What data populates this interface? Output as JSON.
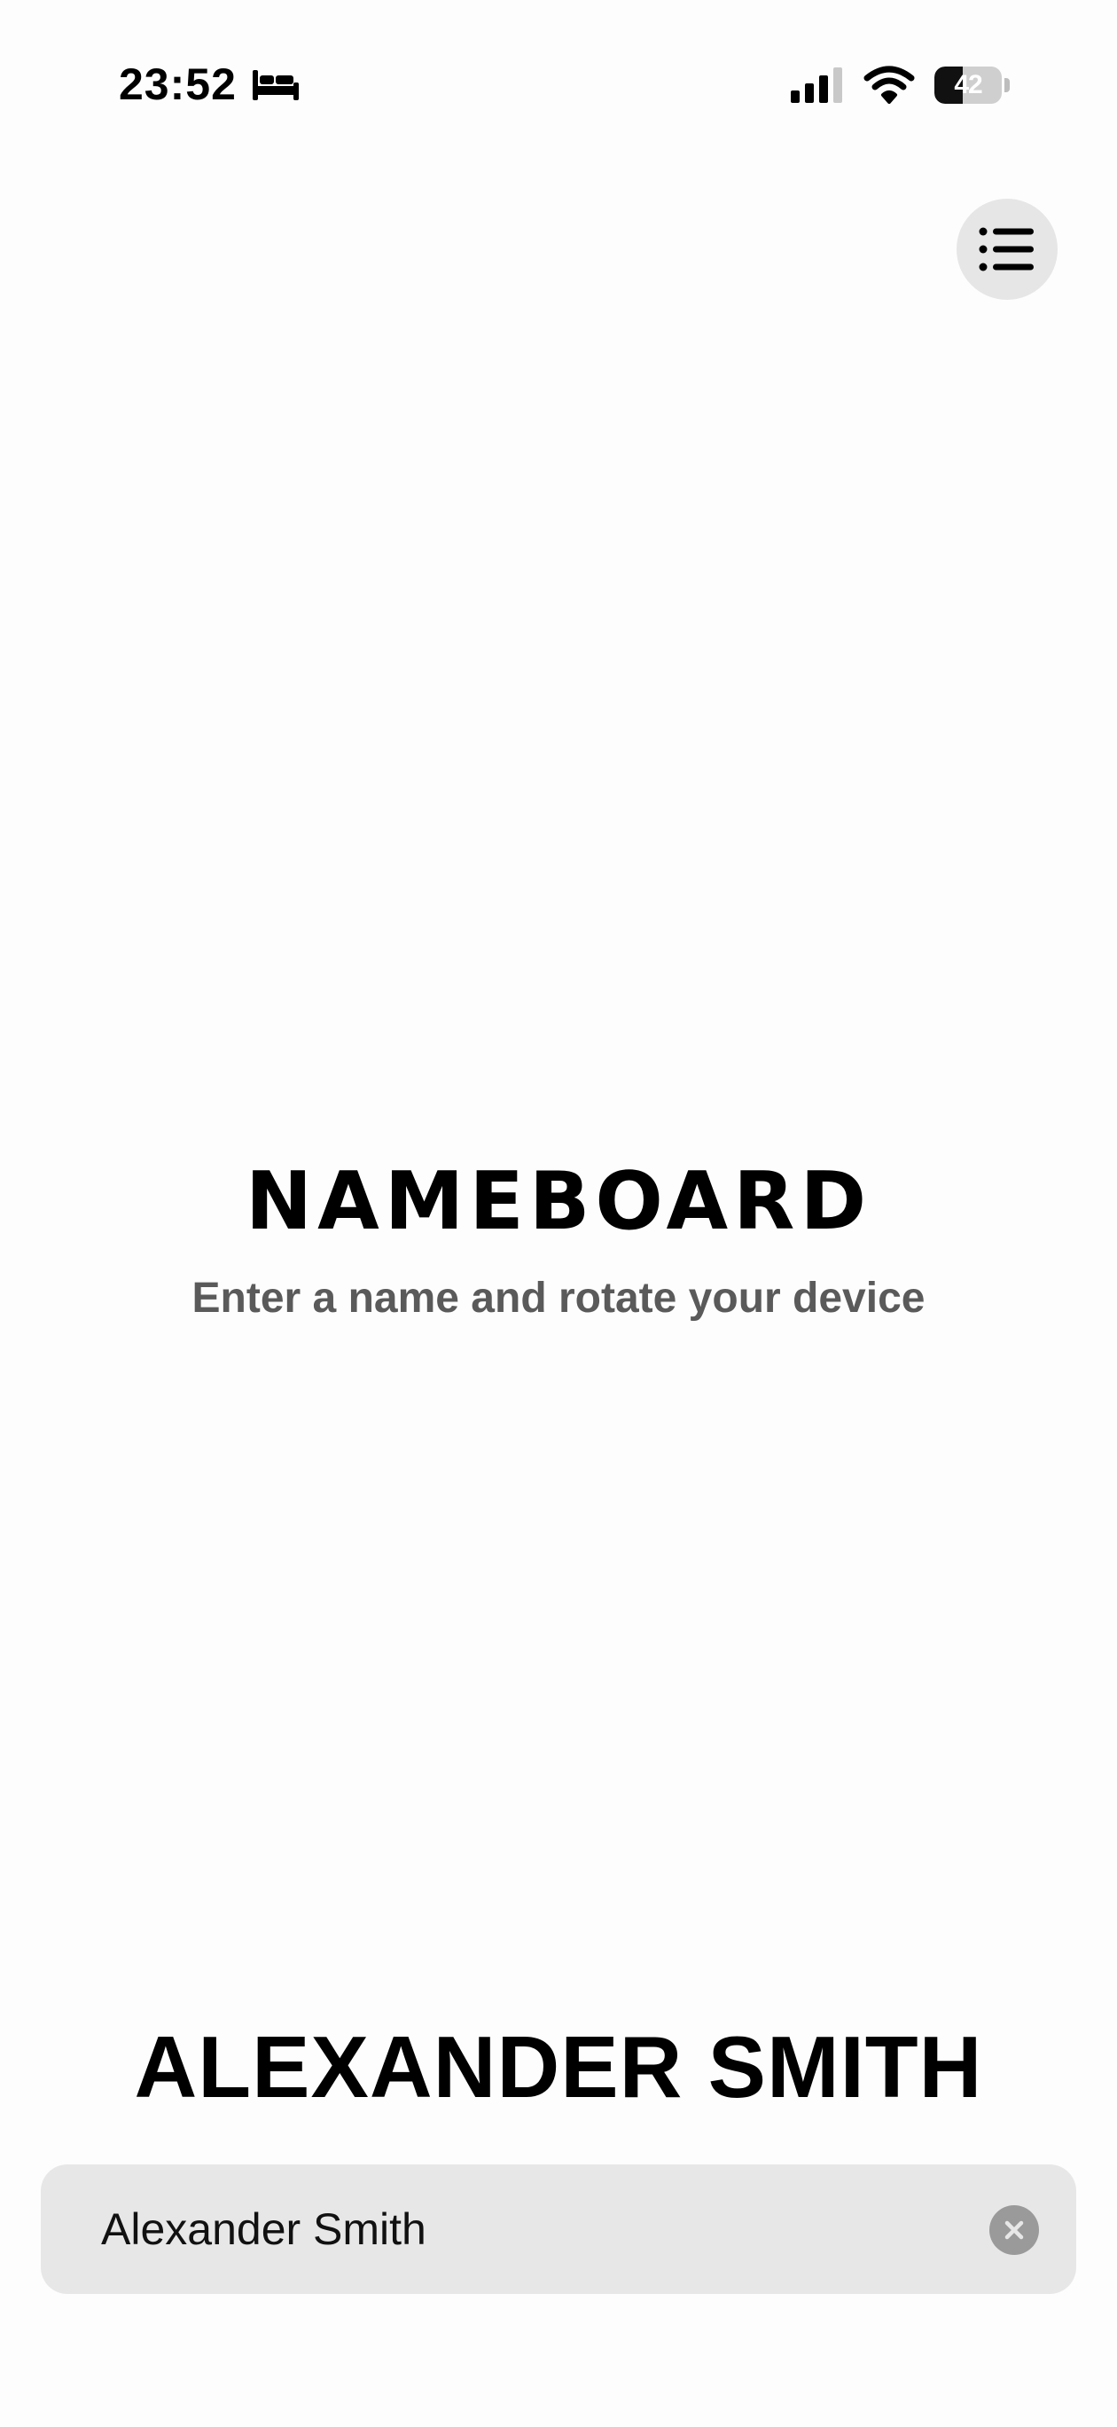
{
  "status_bar": {
    "time": "23:52",
    "focus_icon": "bed-icon",
    "signal_icon": "cellular-signal-icon",
    "wifi_icon": "wifi-icon",
    "battery_level": "42",
    "battery_fraction": 0.42
  },
  "header": {
    "menu_icon": "list-icon"
  },
  "hero": {
    "title": "NAMEBOARD",
    "subtitle": "Enter a name and rotate your device"
  },
  "preview": {
    "name": "ALEXANDER SMITH"
  },
  "name_field": {
    "value": "Alexander Smith",
    "clear_icon": "close-icon"
  },
  "colors": {
    "background": "#fdfdfd",
    "text": "#000000",
    "subtitle": "#5a5a5a",
    "field_background": "#e7e7e7",
    "menu_button_background": "#e6e6e6",
    "clear_button": "#9a9a9a"
  }
}
